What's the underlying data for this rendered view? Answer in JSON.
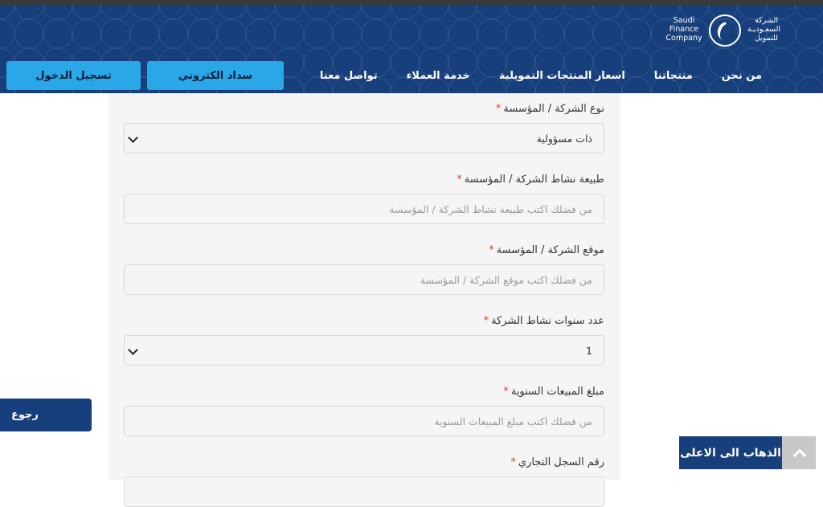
{
  "header": {
    "logo": {
      "ar": [
        "الشركة",
        "السعـوديـة",
        "للتمويل"
      ],
      "en": [
        "Saudi",
        "Finance",
        "Company"
      ]
    },
    "login_label": "تسجيل الدخول",
    "pay_label": "سداد الكتروني",
    "nav": [
      "من نحن",
      "منتجاتنا",
      "اسعار المنتجات التمويلية",
      "خدمة العملاء",
      "تواصل معنا"
    ]
  },
  "form": {
    "fields": [
      {
        "label": "نوع الشركة / المؤسسة",
        "required": "*",
        "type": "select",
        "value": "ذات مسؤولية"
      },
      {
        "label": "طبيعة نشاط الشركة / المؤسسة",
        "required": "*",
        "type": "input",
        "placeholder": "من فضلك اكتب طبيعة نشاط الشركة / المؤسسة"
      },
      {
        "label": "موقع الشركة / المؤسسة",
        "required": "*",
        "type": "input",
        "placeholder": "من فضلك اكتب موقع الشركة / المؤسسة"
      },
      {
        "label": "عدد سنوات نشاط الشركة",
        "required": "*",
        "type": "select",
        "value": "1"
      },
      {
        "label": "مبلغ المبيعات السنوية",
        "required": "*",
        "type": "input",
        "placeholder": "من فضلك اكتب مبلغ المبيعات السنوية"
      },
      {
        "label": "رقم السجل التجاري",
        "required": "*",
        "type": "input",
        "placeholder": ""
      }
    ]
  },
  "back_label": "رجوع",
  "scroll_top_label": "الذهاب الى الاعلى",
  "colors": {
    "header": "#173f7c",
    "button": "#2aa7e6",
    "required": "#e53935"
  }
}
